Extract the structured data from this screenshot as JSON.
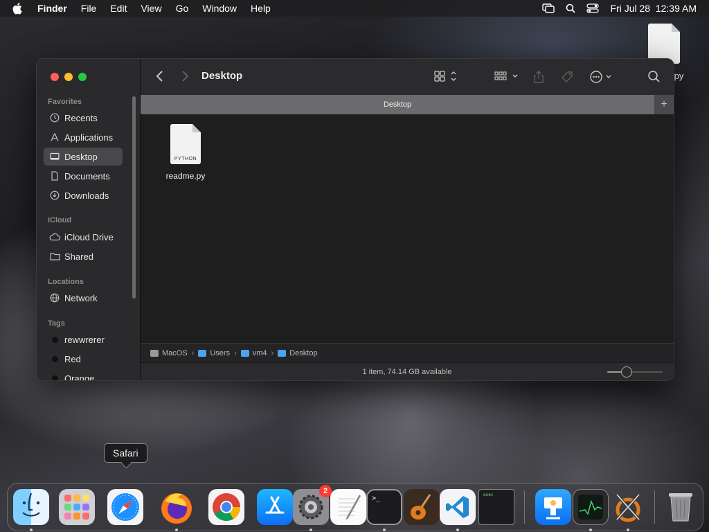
{
  "menubar": {
    "items": [
      "Finder",
      "File",
      "Edit",
      "View",
      "Go",
      "Window",
      "Help"
    ],
    "datetime": "Fri Jul 28  12:39 AM"
  },
  "desktop_file": {
    "label": ".py"
  },
  "window": {
    "title": "Desktop",
    "sidebar": {
      "favorites_heading": "Favorites",
      "favorites": [
        {
          "label": "Recents",
          "icon": "clock-icon"
        },
        {
          "label": "Applications",
          "icon": "applications-icon"
        },
        {
          "label": "Desktop",
          "icon": "desktop-icon",
          "selected": true
        },
        {
          "label": "Documents",
          "icon": "document-icon"
        },
        {
          "label": "Downloads",
          "icon": "download-icon"
        }
      ],
      "icloud_heading": "iCloud",
      "icloud": [
        {
          "label": "iCloud Drive",
          "icon": "cloud-icon"
        },
        {
          "label": "Shared",
          "icon": "shared-folder-icon"
        }
      ],
      "locations_heading": "Locations",
      "locations": [
        {
          "label": "Network",
          "icon": "globe-icon"
        }
      ],
      "tags_heading": "Tags",
      "tags": [
        {
          "label": "rewwrerer",
          "color": "#111111"
        },
        {
          "label": "Red",
          "color": "#111111"
        },
        {
          "label": "Orange",
          "color": "#111111"
        }
      ]
    },
    "tab_label": "Desktop",
    "files": [
      {
        "name": "readme.py",
        "kind": "PYTHON"
      }
    ],
    "path": [
      "MacOS",
      "Users",
      "vm4",
      "Desktop"
    ],
    "status": "1 item, 74.14 GB available",
    "icon_size_fraction": 0.3
  },
  "tooltip": {
    "label": "Safari"
  },
  "dock": {
    "apps": [
      {
        "name": "finder-icon",
        "running": true
      },
      {
        "name": "launchpad-icon",
        "running": false
      },
      {
        "name": "safari-icon",
        "running": false
      },
      {
        "name": "firefox-icon",
        "running": true
      },
      {
        "name": "chrome-icon",
        "running": false
      },
      {
        "name": "app-store-icon",
        "running": false
      },
      {
        "name": "system-settings-icon",
        "running": true,
        "badge": "2"
      },
      {
        "name": "textedit-icon",
        "running": false
      },
      {
        "name": "terminal-icon",
        "running": true
      },
      {
        "name": "garageband-icon",
        "running": false
      },
      {
        "name": "vscode-icon",
        "running": true
      },
      {
        "name": "script-editor-icon",
        "running": false
      },
      {
        "name": "keynote-icon",
        "running": false
      },
      {
        "name": "activity-monitor-icon",
        "running": true
      },
      {
        "name": "x-icon",
        "running": true
      },
      {
        "name": "trash-icon",
        "running": false
      }
    ],
    "terminal_text": ">_",
    "exec_text": "exec"
  },
  "colors": {
    "accent_folder": "#4aa3f5",
    "traffic_close": "#fe5f57",
    "traffic_min": "#febc2e",
    "traffic_max": "#28c840",
    "badge": "#ff3b30"
  }
}
